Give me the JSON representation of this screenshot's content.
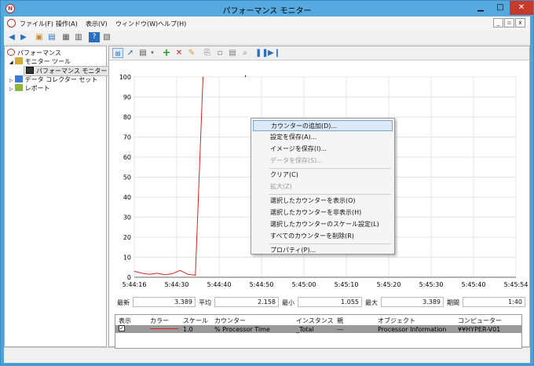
{
  "window": {
    "title": "パフォーマンス モニター",
    "min_glyph": "▁",
    "max_glyph": "□",
    "close_glyph": "✕",
    "app_glyph": "N"
  },
  "menu": {
    "items": [
      "ファイル(F)",
      "操作(A)",
      "表示(V)",
      "ウィンドウ(W)",
      "ヘルプ(H)"
    ],
    "mdi_min": "_",
    "mdi_restore": "▫",
    "mdi_close": "x"
  },
  "tree": {
    "root": "パフォーマンス",
    "monitor_tools": "モニター ツール",
    "perf_monitor": "パフォーマンス モニター",
    "collector_sets": "データ コレクター セット",
    "reports": "レポート"
  },
  "chart_data": {
    "type": "line",
    "yticks": [
      "0",
      "10",
      "20",
      "30",
      "40",
      "50",
      "60",
      "70",
      "80",
      "90",
      "100"
    ],
    "ylim": [
      0,
      100
    ],
    "xticks": [
      "5:44:16",
      "5:44:30",
      "5:44:40",
      "5:44:50",
      "5:45:00",
      "5:45:10",
      "5:45:20",
      "5:45:30",
      "5:45:40",
      "5:45:54"
    ],
    "series": [
      {
        "name": "% Processor Time",
        "color": "#e02020",
        "x": [
          0,
          2,
          4,
          6,
          8,
          10,
          12,
          14,
          16,
          18
        ],
        "values": [
          3.0,
          2.0,
          1.5,
          2.0,
          1.2,
          1.8,
          3.4,
          1.5,
          1.0,
          100
        ]
      }
    ],
    "grid": true
  },
  "stats": {
    "last_label": "最新",
    "last_value": "3.389",
    "avg_label": "平均",
    "avg_value": "2.158",
    "min_label": "最小",
    "min_value": "1.055",
    "max_label": "最大",
    "max_value": "3.389",
    "duration_label": "期間",
    "duration_value": "1:40"
  },
  "legend": {
    "headers": [
      "表示",
      "カラー",
      "スケール",
      "カウンター",
      "インスタンス",
      "親",
      "オブジェクト",
      "コンピューター"
    ],
    "row": {
      "show": "✓",
      "scale": "1.0",
      "counter": "% Processor Time",
      "instance": "_Total",
      "parent": "---",
      "object": "Processor Information",
      "computer": "¥¥HYPER-V01"
    }
  },
  "context_menu": {
    "items": [
      {
        "label": "カウンターの追加(D)...",
        "state": "highlighted"
      },
      {
        "label": "設定を保存(A)...",
        "state": "normal"
      },
      {
        "label": "イメージを保存(I)...",
        "state": "normal"
      },
      {
        "label": "データを保存(S)...",
        "state": "disabled"
      },
      {
        "label": "クリア(C)",
        "state": "normal"
      },
      {
        "label": "拡大(Z)",
        "state": "disabled"
      },
      {
        "label": "選択したカウンターを表示(O)",
        "state": "normal"
      },
      {
        "label": "選択したカウンターを非表示(H)",
        "state": "normal"
      },
      {
        "label": "選択したカウンターのスケール設定(L)",
        "state": "normal"
      },
      {
        "label": "すべてのカウンターを削除(R)",
        "state": "normal"
      },
      {
        "label": "プロパティ(P)...",
        "state": "normal"
      }
    ]
  }
}
